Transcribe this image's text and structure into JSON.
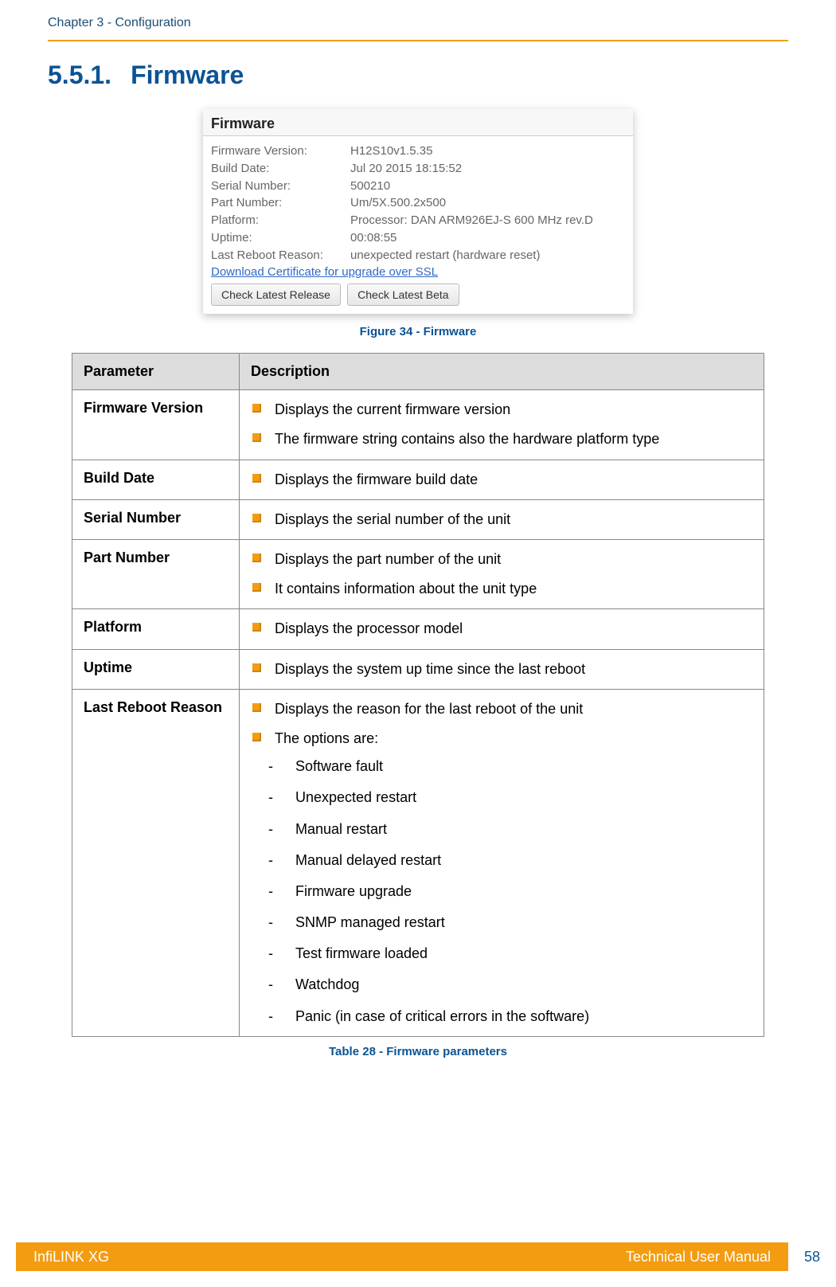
{
  "header": {
    "chapter": "Chapter 3 - Configuration"
  },
  "section": {
    "number": "5.5.1.",
    "title": "Firmware"
  },
  "panel": {
    "title": "Firmware",
    "rows": [
      {
        "k": "Firmware Version:",
        "v": "H12S10v1.5.35"
      },
      {
        "k": "Build Date:",
        "v": "Jul 20 2015 18:15:52"
      },
      {
        "k": "Serial Number:",
        "v": "500210"
      },
      {
        "k": "Part Number:",
        "v": "Um/5X.500.2x500"
      },
      {
        "k": "Platform:",
        "v": "Processor: DAN ARM926EJ-S 600 MHz rev.D"
      },
      {
        "k": "Uptime:",
        "v": "00:08:55"
      },
      {
        "k": "Last Reboot Reason:",
        "v": "unexpected restart (hardware reset)"
      }
    ],
    "link": "Download Certificate for upgrade over SSL",
    "btn1": "Check Latest Release",
    "btn2": "Check Latest Beta"
  },
  "figure_caption": "Figure 34 - Firmware",
  "table": {
    "h1": "Parameter",
    "h2": "Description",
    "rows": [
      {
        "param": "Firmware Version",
        "items": [
          "Displays the current firmware version",
          "The firmware string contains also the hardware platform type"
        ]
      },
      {
        "param": "Build Date",
        "items": [
          "Displays the firmware build date"
        ]
      },
      {
        "param": "Serial Number",
        "items": [
          "Displays the serial number of the unit"
        ]
      },
      {
        "param": "Part Number",
        "items": [
          "Displays the part number of the unit",
          "It contains information about the unit type"
        ]
      },
      {
        "param": "Platform",
        "items": [
          "Displays the processor model"
        ]
      },
      {
        "param": "Uptime",
        "items": [
          "Displays the system up time since the last reboot"
        ]
      },
      {
        "param": "Last Reboot Reason",
        "items": [
          "Displays the reason for the last reboot of the unit",
          "The options are:"
        ],
        "sub": [
          "Software fault",
          "Unexpected restart",
          "Manual restart",
          "Manual delayed restart",
          "Firmware upgrade",
          "SNMP managed restart",
          "Test firmware loaded",
          "Watchdog",
          "Panic (in case of critical errors in the software)"
        ]
      }
    ]
  },
  "table_caption": "Table 28 - Firmware parameters",
  "footer": {
    "left": "InfiLINK XG",
    "right": "Technical User Manual",
    "page": "58"
  }
}
